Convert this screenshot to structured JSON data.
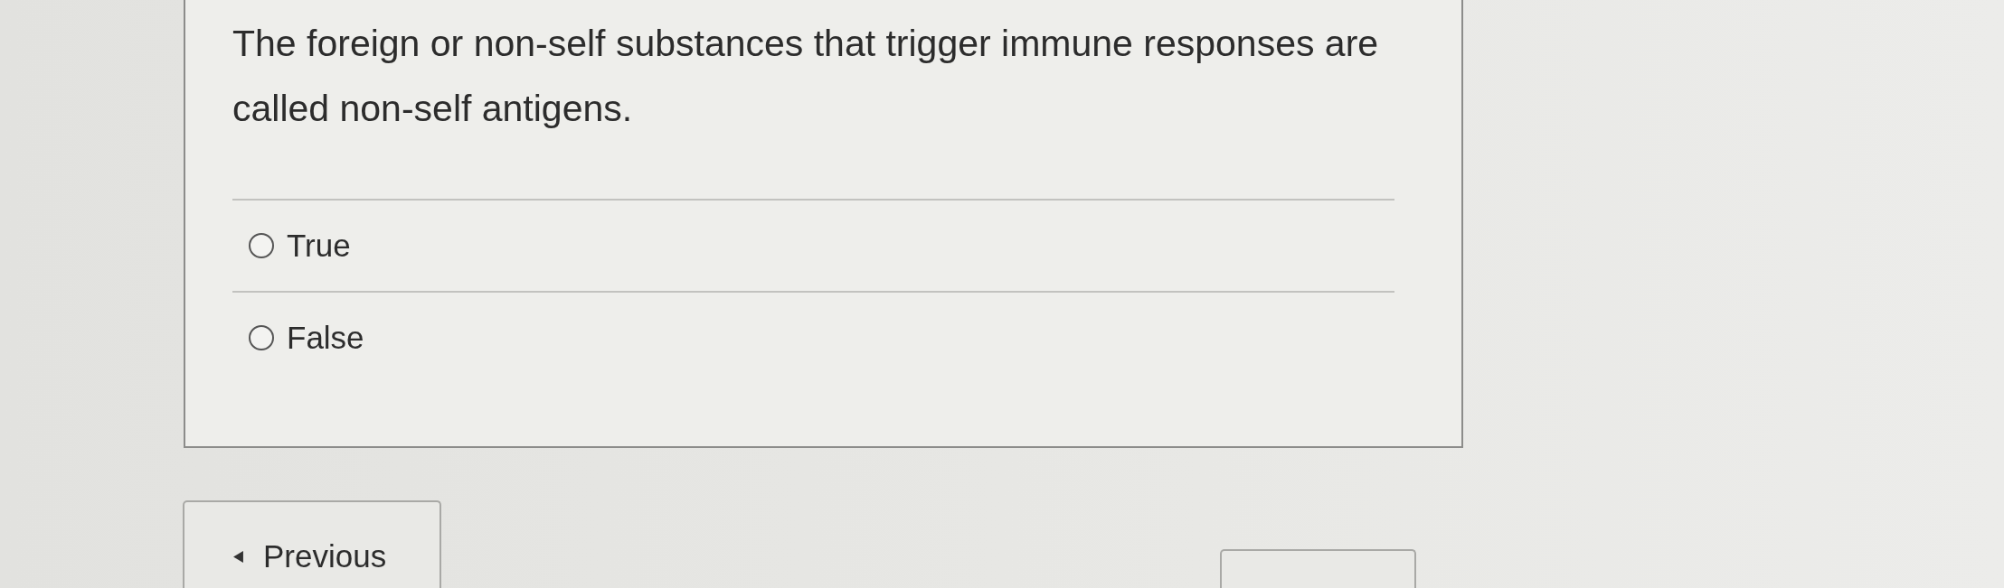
{
  "question": {
    "text": "The foreign or non-self substances that trigger immune responses are called non-self antigens."
  },
  "options": [
    {
      "label": "True",
      "selected": false
    },
    {
      "label": "False",
      "selected": false
    }
  ],
  "buttons": [
    {
      "kind": "previous",
      "label": "Previous"
    },
    {
      "kind": "next"
    }
  ]
}
